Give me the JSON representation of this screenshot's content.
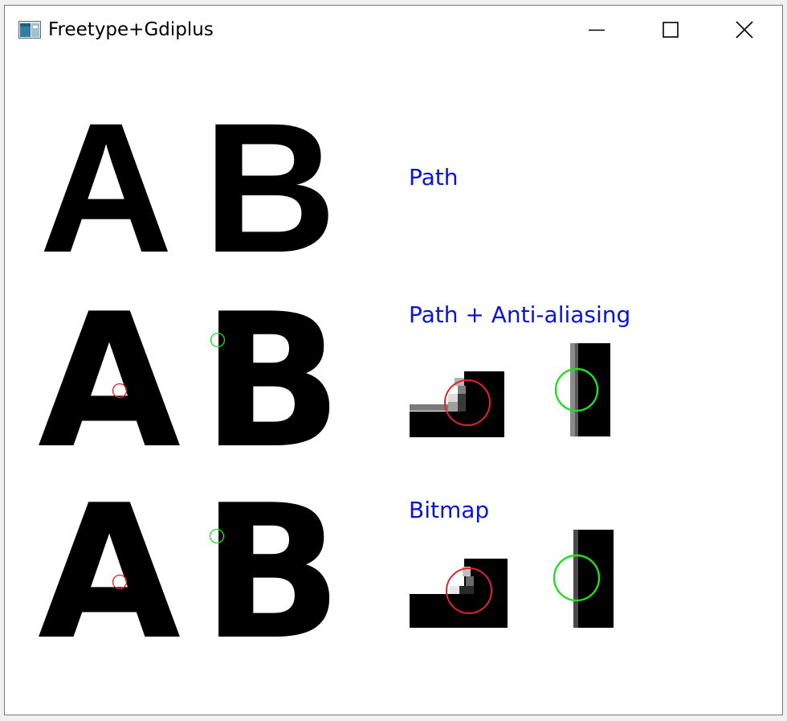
{
  "window": {
    "title": "Freetype+Gdiplus",
    "controls": {
      "minimize": "minimize-icon",
      "maximize": "maximize-icon",
      "close": "close-icon"
    }
  },
  "rows": [
    {
      "letters": [
        "A",
        "B"
      ],
      "label": "Path"
    },
    {
      "letters": [
        "A",
        "B"
      ],
      "label": "Path + Anti-aliasing"
    },
    {
      "letters": [
        "A",
        "B"
      ],
      "label": "Bitmap"
    }
  ],
  "colors": {
    "label": "#0a14d6",
    "marker_red": "#e0262a",
    "marker_green": "#22dd22",
    "glyph": "#000000"
  }
}
